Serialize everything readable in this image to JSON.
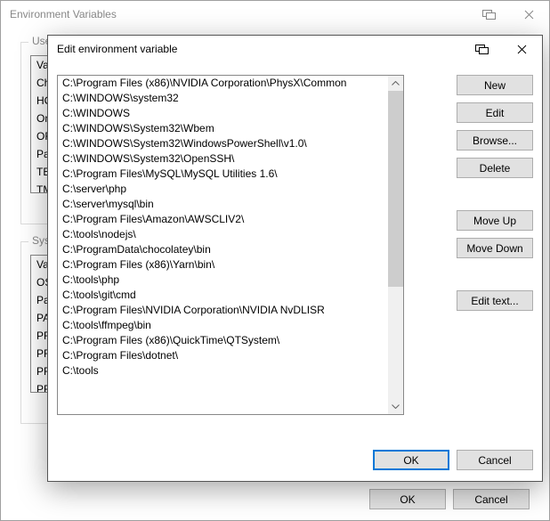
{
  "parent": {
    "title": "Environment Variables",
    "user_label": "User",
    "system_label": "Syste",
    "user_var_col": [
      "Va",
      "Ch",
      "HC",
      "On",
      "OF",
      "Pa",
      "TE",
      "TM"
    ],
    "system_var_col": [
      "Va",
      "OS",
      "Pa",
      "PA",
      "PF",
      "PF",
      "PF",
      "PF"
    ],
    "ok_label": "OK",
    "cancel_label": "Cancel"
  },
  "modal": {
    "title": "Edit environment variable",
    "paths": [
      "C:\\Program Files (x86)\\NVIDIA Corporation\\PhysX\\Common",
      "C:\\WINDOWS\\system32",
      "C:\\WINDOWS",
      "C:\\WINDOWS\\System32\\Wbem",
      "C:\\WINDOWS\\System32\\WindowsPowerShell\\v1.0\\",
      "C:\\WINDOWS\\System32\\OpenSSH\\",
      "C:\\Program Files\\MySQL\\MySQL Utilities 1.6\\",
      "C:\\server\\php",
      "C:\\server\\mysql\\bin",
      "C:\\Program Files\\Amazon\\AWSCLIV2\\",
      "C:\\tools\\nodejs\\",
      "C:\\ProgramData\\chocolatey\\bin",
      "C:\\Program Files (x86)\\Yarn\\bin\\",
      "C:\\tools\\php",
      "C:\\tools\\git\\cmd",
      "C:\\Program Files\\NVIDIA Corporation\\NVIDIA NvDLISR",
      "C:\\tools\\ffmpeg\\bin",
      "C:\\Program Files (x86)\\QuickTime\\QTSystem\\",
      "C:\\Program Files\\dotnet\\",
      "C:\\tools"
    ],
    "buttons": {
      "new": "New",
      "edit": "Edit",
      "browse": "Browse...",
      "delete": "Delete",
      "move_up": "Move Up",
      "move_down": "Move Down",
      "edit_text": "Edit text..."
    },
    "ok_label": "OK",
    "cancel_label": "Cancel"
  }
}
